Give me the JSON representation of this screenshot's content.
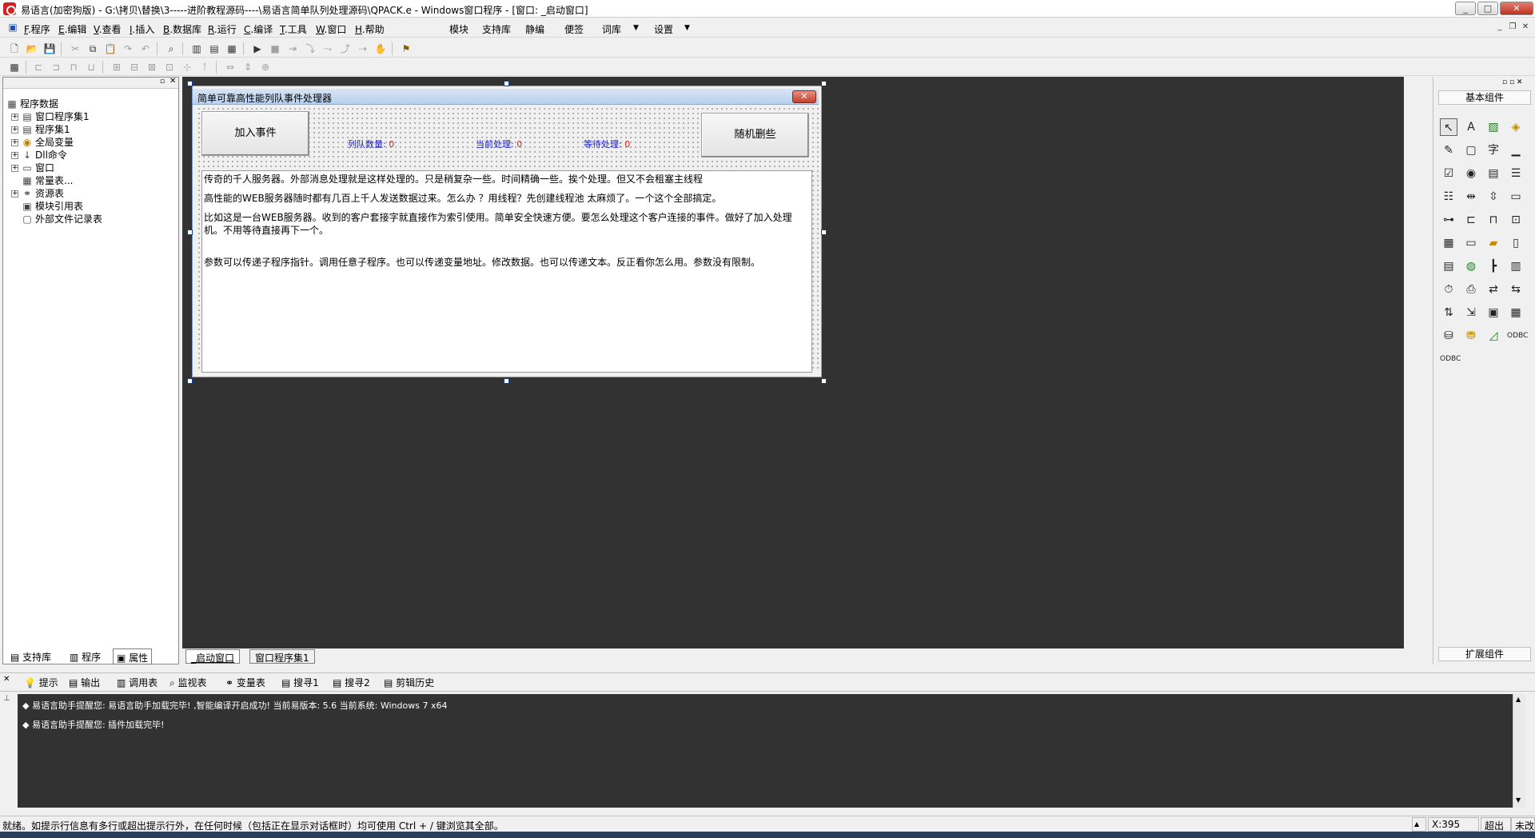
{
  "window": {
    "title": "易语言(加密狗版) - G:\\拷贝\\替换\\3-----进阶教程源码----\\易语言简单队列处理源码\\QPACK.e - Windows窗口程序 - [窗口: _启动窗口]",
    "min": "_",
    "max": "□",
    "close": "✕"
  },
  "menu": {
    "items": [
      {
        "key": "F",
        "label": ".程序"
      },
      {
        "key": "E",
        "label": ".编辑"
      },
      {
        "key": "V",
        "label": ".查看"
      },
      {
        "key": "I",
        "label": ".插入"
      },
      {
        "key": "B",
        "label": ".数据库"
      },
      {
        "key": "R",
        "label": ".运行"
      },
      {
        "key": "C",
        "label": ".编译"
      },
      {
        "key": "T",
        "label": ".工具"
      },
      {
        "key": "W",
        "label": ".窗口"
      },
      {
        "key": "H",
        "label": ".帮助"
      }
    ],
    "extra": [
      "模块",
      "支持库",
      "静编",
      "便签",
      "词库",
      "设置"
    ]
  },
  "left_panel": {
    "root": "程序数据",
    "tree": [
      {
        "label": "窗口程序集1",
        "exp": "+",
        "icon": "▤"
      },
      {
        "label": "程序集1",
        "exp": "+",
        "icon": "▤"
      },
      {
        "label": "全局变量",
        "exp": "+",
        "icon": "◉"
      },
      {
        "label": "Dll命令",
        "exp": "+",
        "icon": "↓"
      },
      {
        "label": "窗口",
        "exp": "+",
        "icon": "▭"
      },
      {
        "label": "常量表...",
        "exp": "",
        "icon": "▦"
      },
      {
        "label": "资源表",
        "exp": "+",
        "icon": "⚭"
      },
      {
        "label": "模块引用表",
        "exp": "",
        "icon": "▣"
      },
      {
        "label": "外部文件记录表",
        "exp": "",
        "icon": "▢"
      }
    ],
    "tabs": [
      "支持库",
      "程序",
      "属性"
    ]
  },
  "form": {
    "title": "简单可靠高性能列队事件处理器",
    "btn_add": "加入事件",
    "btn_random_delete": "随机删些",
    "queue_count_label": "列队数量:",
    "queue_count_value": "0",
    "current_label": "当前处理:",
    "current_value": "0",
    "waiting_label": "等待处理:",
    "waiting_value": "0",
    "text_lines": [
      "传奇的千人服务器。外部消息处理就是这样处理的。只是稍复杂一些。时间精确一些。挨个处理。但又不会租塞主线程",
      "高性能的WEB服务器随时都有几百上千人发送数据过来。怎么办 ？用线程？先创建线程池 太麻烦了。一个这个全部搞定。",
      "比如这是一台WEB服务器。收到的客户套接字就直接作为索引使用。简单安全快速方便。要怎么处理这个客户连接的事件。做好了加入处理机。不用等待直接再下一个。",
      "参数可以传递子程序指针。调用任意子程序。也可以传递变量地址。修改数据。也可以传递文本。反正看你怎么用。参数没有限制。"
    ]
  },
  "editor_tabs": [
    "_启动窗口",
    "窗口程序集1"
  ],
  "right_panel": {
    "header": "基本组件",
    "footer": "扩展组件"
  },
  "output_tabs": [
    "提示",
    "输出",
    "调用表",
    "监视表",
    "变量表",
    "搜寻1",
    "搜寻2",
    "剪辑历史"
  ],
  "output_lines": [
    "◆ 易语言助手提醒您: 易语言助手加载完毕! ,智能编译开启成功! 当前易版本: 5.6 当前系统: Windows 7 x64",
    "◆ 易语言助手提醒您: 插件加载完毕!"
  ],
  "status": {
    "message": "就绪。如提示行信息有多行或超出提示行外，在任何时候（包括正在显示对话框时）均可使用 Ctrl + / 键浏览其全部。",
    "x": "X:395",
    "overwrite": "超出",
    "modified": "未改"
  }
}
